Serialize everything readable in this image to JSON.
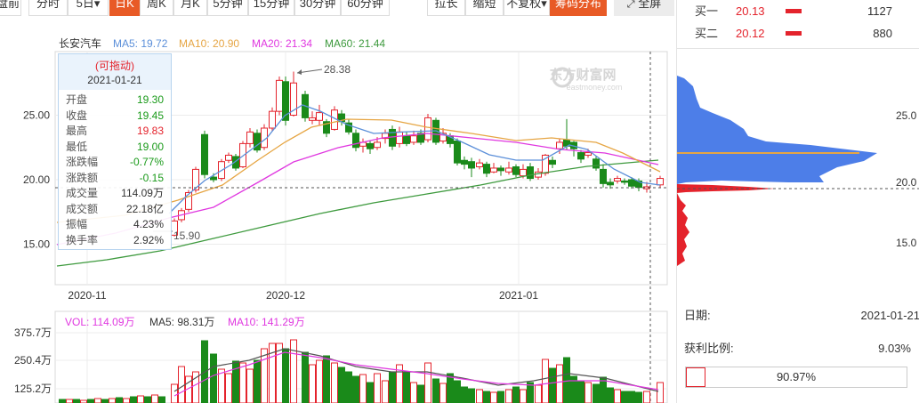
{
  "toolbar": {
    "left_buttons": [
      {
        "label": "盘前",
        "x": -6,
        "w": 30,
        "on": false
      },
      {
        "label": "分时",
        "x": 32,
        "w": 44,
        "on": false
      },
      {
        "label": "5日▾",
        "x": 76,
        "w": 46,
        "on": false
      },
      {
        "label": "日K",
        "x": 123,
        "w": 34,
        "on": true
      },
      {
        "label": "周K",
        "x": 157,
        "w": 38,
        "on": false
      },
      {
        "label": "月K",
        "x": 195,
        "w": 38,
        "on": false
      },
      {
        "label": "5分钟",
        "x": 233,
        "w": 46,
        "on": false
      },
      {
        "label": "15分钟",
        "x": 279,
        "w": 52,
        "on": false
      },
      {
        "label": "30分钟",
        "x": 331,
        "w": 52,
        "on": false
      },
      {
        "label": "60分钟",
        "x": 383,
        "w": 55,
        "on": false
      }
    ],
    "right_buttons": [
      {
        "label": "拉长",
        "x": 480,
        "w": 43,
        "on": false
      },
      {
        "label": "缩短",
        "x": 523,
        "w": 43,
        "on": false
      },
      {
        "label": "不复权▾",
        "x": 566,
        "w": 52,
        "on": false
      },
      {
        "label": "筹码分布",
        "x": 618,
        "w": 64,
        "on": true
      }
    ],
    "fullscreen_label": "全屏"
  },
  "chart": {
    "stock_name": "长安汽车",
    "ma": {
      "ma5": "MA5: 19.72",
      "ma10": "MA10: 20.90",
      "ma20": "MA20: 21.34",
      "ma60": "MA60: 21.44"
    },
    "y_ticks": [
      "25.00",
      "20.00",
      "15.00"
    ],
    "x_ticks": [
      "2020-11",
      "2020-12",
      "2021-01"
    ],
    "high_label": "28.38",
    "low_label": "15.90",
    "watermark": "东方财富网",
    "watermark_sub": "eastmoney.com",
    "colors": {
      "up": "#e4232c",
      "down": "#1a8a1a",
      "ma5": "#5b8fd9",
      "ma10": "#e6a543",
      "ma20": "#e038e0",
      "ma60": "#3e9a3e"
    }
  },
  "tooltip": {
    "drag_hint": "(可拖动)",
    "date": "2021-01-21",
    "rows": [
      {
        "k": "开盘",
        "v": "19.30",
        "c": "green"
      },
      {
        "k": "收盘",
        "v": "19.45",
        "c": "green"
      },
      {
        "k": "最高",
        "v": "19.83",
        "c": "red"
      },
      {
        "k": "最低",
        "v": "19.00",
        "c": "green"
      },
      {
        "k": "涨跌幅",
        "v": "-0.77%",
        "c": "green"
      },
      {
        "k": "涨跌额",
        "v": "-0.15",
        "c": "green"
      },
      {
        "k": "成交量",
        "v": "114.09万",
        "c": ""
      },
      {
        "k": "成交额",
        "v": "22.18亿",
        "c": ""
      },
      {
        "k": "振幅",
        "v": "4.23%",
        "c": ""
      },
      {
        "k": "换手率",
        "v": "2.92%",
        "c": ""
      }
    ]
  },
  "volume": {
    "vol": "VOL: 114.09万",
    "ma5": "MA5: 98.31万",
    "ma10": "MA10: 141.29万",
    "y_ticks": [
      "375.7万",
      "250.4万",
      "125.2万"
    ]
  },
  "orderbook": [
    {
      "label": "买一",
      "price": "20.13",
      "qty": "1127"
    },
    {
      "label": "买二",
      "price": "20.12",
      "qty": "880"
    }
  ],
  "chip": {
    "y_ticks": [
      "25.0",
      "20.0",
      "15.0"
    ],
    "date_label": "日期:",
    "date_value": "2021-01-21",
    "profit_label": "获利比例:",
    "profit_value": "9.03%",
    "holding_percent": "90.97%"
  }
}
